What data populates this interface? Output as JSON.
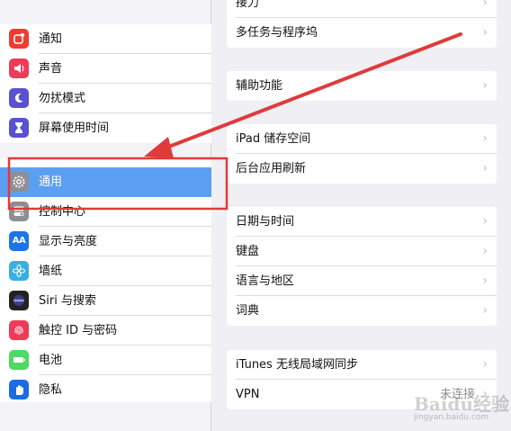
{
  "colors": {
    "selection": "#5b9ff2",
    "annotation_red": "#e03a3a"
  },
  "sidebar": {
    "group1": [
      {
        "label": "通知",
        "icon": "notifications-icon",
        "color": "#ef3b30"
      },
      {
        "label": "声音",
        "icon": "sounds-icon",
        "color": "#ef3b58"
      },
      {
        "label": "勿扰模式",
        "icon": "do-not-disturb-icon",
        "color": "#5a51d2"
      },
      {
        "label": "屏幕使用时间",
        "icon": "screen-time-icon",
        "color": "#5a51d2"
      }
    ],
    "group2": [
      {
        "label": "通用",
        "icon": "gear-icon",
        "color": "#8e8e93",
        "selected": true
      },
      {
        "label": "控制中心",
        "icon": "control-center-icon",
        "color": "#8e8e93"
      },
      {
        "label": "显示与亮度",
        "icon": "display-brightness-icon",
        "color": "#1c74e6"
      },
      {
        "label": "墙纸",
        "icon": "wallpaper-icon",
        "color": "#38b0e0"
      },
      {
        "label": "Siri 与搜索",
        "icon": "siri-icon",
        "color": "#222222"
      },
      {
        "label": "触控 ID 与密码",
        "icon": "touch-id-icon",
        "color": "#ef3b58"
      },
      {
        "label": "电池",
        "icon": "battery-icon",
        "color": "#4cd964"
      },
      {
        "label": "隐私",
        "icon": "privacy-hand-icon",
        "color": "#1c6be0"
      }
    ]
  },
  "detail": {
    "group1": [
      {
        "label": "接力"
      },
      {
        "label": "多任务与程序坞"
      }
    ],
    "group2": [
      {
        "label": "辅助功能"
      }
    ],
    "group3": [
      {
        "label": "iPad 储存空间"
      },
      {
        "label": "后台应用刷新"
      }
    ],
    "group4": [
      {
        "label": "日期与时间"
      },
      {
        "label": "键盘"
      },
      {
        "label": "语言与地区"
      },
      {
        "label": "词典"
      }
    ],
    "group5": [
      {
        "label": "iTunes 无线局域网同步"
      },
      {
        "label": "VPN",
        "value": "未连接"
      }
    ]
  },
  "watermark": {
    "logo": "Baidu经验",
    "site": "jingyan.baidu.com"
  }
}
